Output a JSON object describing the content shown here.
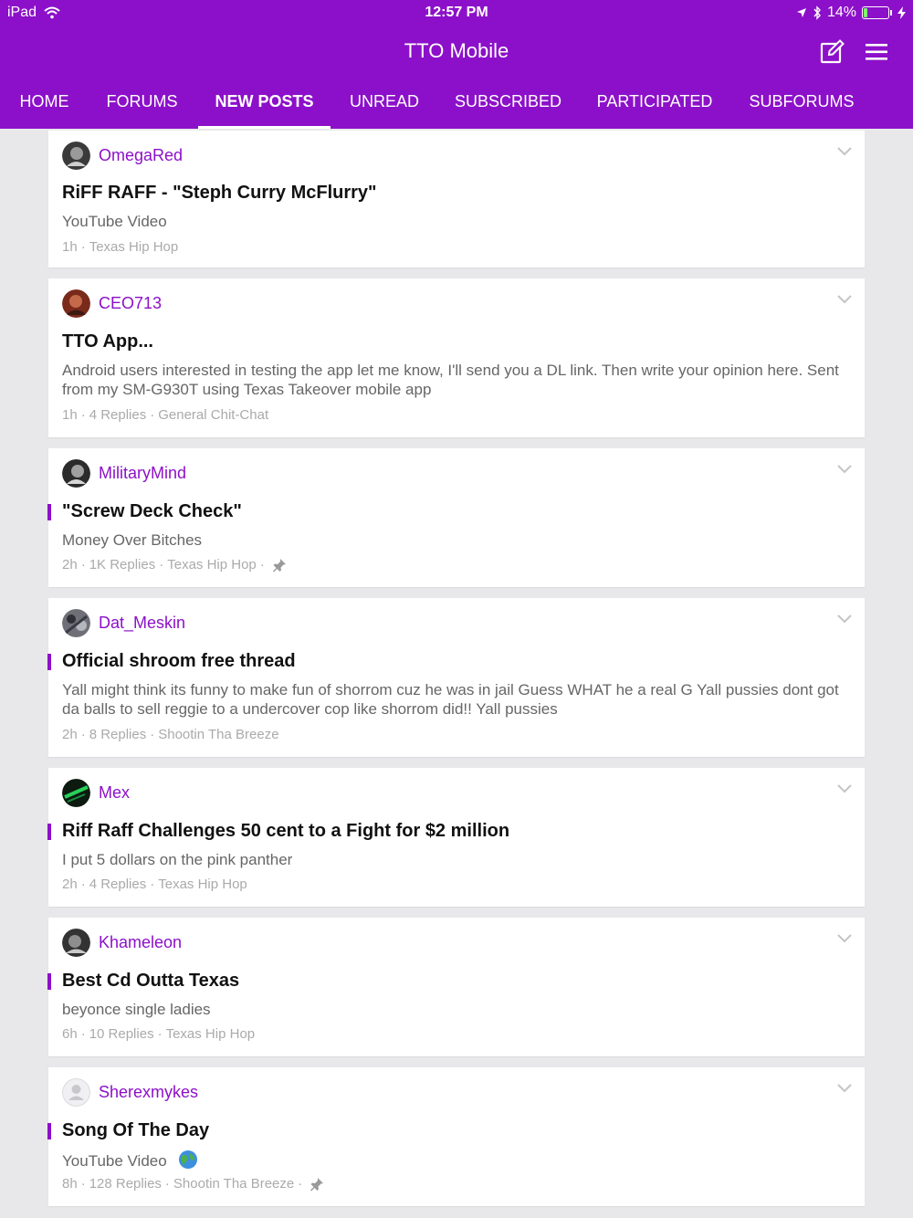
{
  "status_bar": {
    "device": "iPad",
    "time": "12:57 PM",
    "battery_percent": "14%",
    "battery_level": 0.14
  },
  "app": {
    "title": "TTO Mobile",
    "accent_color": "#8c10c9"
  },
  "tabs": [
    {
      "label": "HOME",
      "active": false
    },
    {
      "label": "FORUMS",
      "active": false
    },
    {
      "label": "NEW POSTS",
      "active": true
    },
    {
      "label": "UNREAD",
      "active": false
    },
    {
      "label": "SUBSCRIBED",
      "active": false
    },
    {
      "label": "PARTICIPATED",
      "active": false
    },
    {
      "label": "SUBFORUMS",
      "active": false
    }
  ],
  "posts": [
    {
      "username": "OmegaRed",
      "title": "RiFF RAFF - \"Steph Curry McFlurry\"",
      "preview": "YouTube Video",
      "time": "1h",
      "replies": "",
      "forum": "Texas Hip Hop",
      "pinned": false,
      "accent": false,
      "avatar_icon": "avatar-dark"
    },
    {
      "username": "CEO713",
      "title": "TTO App...",
      "preview": "Android users interested in testing the app let me know, I'll send you a DL link. Then write your opinion here.   Sent from my SM-G930T using Texas Takeover mobile app",
      "time": "1h",
      "replies": "4 Replies",
      "forum": "General Chit-Chat",
      "pinned": false,
      "accent": false,
      "avatar_icon": "avatar-red"
    },
    {
      "username": "MilitaryMind",
      "title": "\"Screw Deck Check\"",
      "preview": "Money Over Bitches",
      "time": "2h",
      "replies": "1K Replies",
      "forum": "Texas Hip Hop",
      "pinned": true,
      "accent": true,
      "avatar_icon": "avatar-dark"
    },
    {
      "username": "Dat_Meskin",
      "title": "Official shroom free thread",
      "preview": "Yall might think its funny to make fun of shorrom cuz he was in jail Guess WHAT he a real G Yall pussies dont got da balls to sell reggie to a undercover cop like shorrom did!! Yall pussies",
      "time": "2h",
      "replies": "8 Replies",
      "forum": "Shootin Tha Breeze",
      "pinned": false,
      "accent": true,
      "avatar_icon": "avatar-grey"
    },
    {
      "username": "Mex",
      "title": "Riff Raff Challenges 50 cent to a Fight for $2 million",
      "preview": "I put 5 dollars on the pink panther",
      "time": "2h",
      "replies": "4 Replies",
      "forum": "Texas Hip Hop",
      "pinned": false,
      "accent": true,
      "avatar_icon": "avatar-green"
    },
    {
      "username": "Khameleon",
      "title": "Best Cd Outta Texas",
      "preview": "beyonce single ladies",
      "time": "6h",
      "replies": "10 Replies",
      "forum": "Texas Hip Hop",
      "pinned": false,
      "accent": true,
      "avatar_icon": "avatar-dark"
    },
    {
      "username": "Sherexmykes",
      "title": "Song Of The Day",
      "preview": "YouTube Video",
      "time": "8h",
      "replies": "128 Replies",
      "forum": "Shootin Tha Breeze",
      "pinned": true,
      "accent": true,
      "avatar_icon": "avatar-default",
      "preview_icon": "globe-icon"
    }
  ]
}
